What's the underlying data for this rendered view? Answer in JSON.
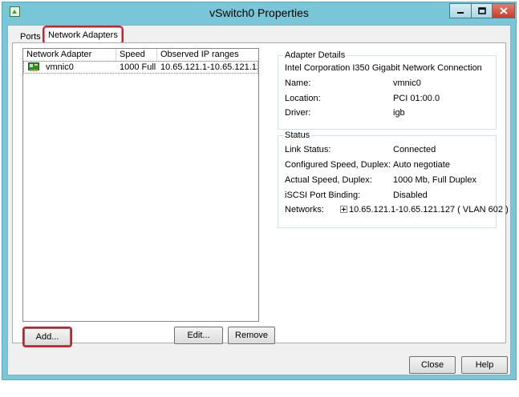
{
  "window": {
    "title": "vSwitch0 Properties"
  },
  "tabs": [
    {
      "label": "Ports"
    },
    {
      "label": "Network Adapters"
    }
  ],
  "adapters_table": {
    "columns": [
      "Network Adapter",
      "Speed",
      "Observed IP ranges"
    ],
    "rows": [
      {
        "name": "vmnic0",
        "speed": "1000 Full",
        "ip_ranges": "10.65.121.1-10.65.121.127..."
      }
    ]
  },
  "buttons": {
    "add": "Add...",
    "edit": "Edit...",
    "remove": "Remove",
    "close": "Close",
    "help": "Help"
  },
  "adapter_details": {
    "legend": "Adapter Details",
    "description": "Intel Corporation I350 Gigabit Network Connection",
    "name_label": "Name:",
    "name_value": "vmnic0",
    "location_label": "Location:",
    "location_value": "PCI 01:00.0",
    "driver_label": "Driver:",
    "driver_value": "igb"
  },
  "status": {
    "legend": "Status",
    "link_status_label": "Link Status:",
    "link_status_value": "Connected",
    "configured_speed_label": "Configured Speed, Duplex:",
    "configured_speed_value": "Auto negotiate",
    "actual_speed_label": "Actual Speed, Duplex:",
    "actual_speed_value": "1000 Mb, Full Duplex",
    "iscsi_label": "iSCSI Port Binding:",
    "iscsi_value": "Disabled",
    "networks_label": "Networks:",
    "networks_value": "10.65.121.1-10.65.121.127 ( VLAN 602 )"
  },
  "colors": {
    "window_frame": "#79c6d8",
    "close_button": "#c5402d",
    "highlight": "#d11a2a"
  },
  "icons": [
    "app-icon",
    "minimize-icon",
    "maximize-icon",
    "close-icon",
    "nic-icon",
    "expand-icon"
  ]
}
